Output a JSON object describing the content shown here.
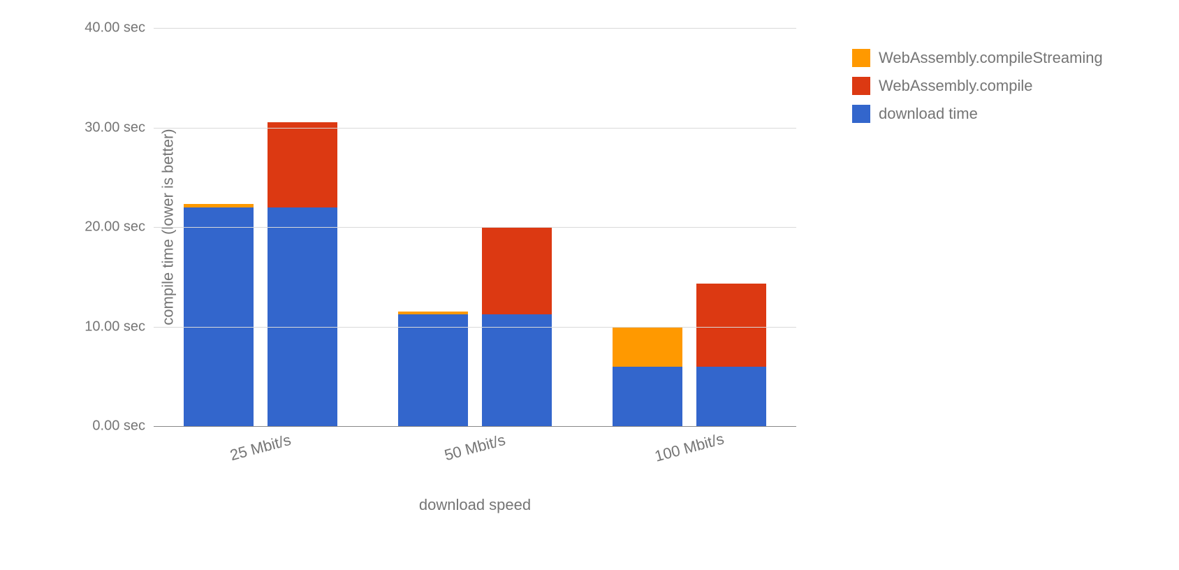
{
  "chart_data": {
    "type": "bar",
    "xlabel": "download speed",
    "ylabel": "compile time (lower is better)",
    "categories": [
      "25 Mbit/s",
      "50 Mbit/s",
      "100 Mbit/s"
    ],
    "y_ticks": [
      "0.00 sec",
      "10.00 sec",
      "20.00 sec",
      "30.00 sec",
      "40.00 sec"
    ],
    "ylim": [
      0,
      40
    ],
    "groups": [
      {
        "category": "25 Mbit/s",
        "bars": [
          {
            "stack": [
              {
                "series": "download time",
                "value": 22.0
              },
              {
                "series": "WebAssembly.compileStreaming",
                "value": 0.3
              }
            ]
          },
          {
            "stack": [
              {
                "series": "download time",
                "value": 22.0
              },
              {
                "series": "WebAssembly.compile",
                "value": 8.5
              }
            ]
          }
        ]
      },
      {
        "category": "50 Mbit/s",
        "bars": [
          {
            "stack": [
              {
                "series": "download time",
                "value": 11.2
              },
              {
                "series": "WebAssembly.compileStreaming",
                "value": 0.3
              }
            ]
          },
          {
            "stack": [
              {
                "series": "download time",
                "value": 11.2
              },
              {
                "series": "WebAssembly.compile",
                "value": 8.8
              }
            ]
          }
        ]
      },
      {
        "category": "100 Mbit/s",
        "bars": [
          {
            "stack": [
              {
                "series": "download time",
                "value": 6.0
              },
              {
                "series": "WebAssembly.compileStreaming",
                "value": 4.0
              }
            ]
          },
          {
            "stack": [
              {
                "series": "download time",
                "value": 6.0
              },
              {
                "series": "WebAssembly.compile",
                "value": 8.3
              }
            ]
          }
        ]
      }
    ],
    "legend": [
      {
        "label": "WebAssembly.compileStreaming",
        "color": "#ff9900"
      },
      {
        "label": "WebAssembly.compile",
        "color": "#dc3912"
      },
      {
        "label": "download time",
        "color": "#3366cc"
      }
    ],
    "series_colors": {
      "download time": "#3366cc",
      "WebAssembly.compile": "#dc3912",
      "WebAssembly.compileStreaming": "#ff9900"
    }
  }
}
